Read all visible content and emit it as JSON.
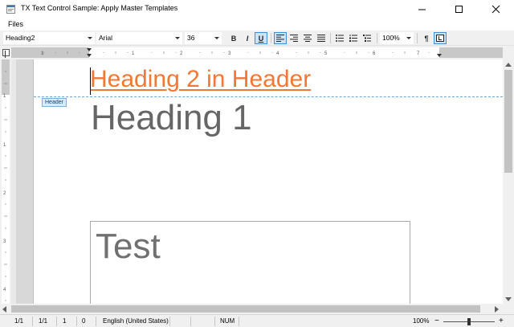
{
  "window": {
    "title": "TX Text Control Sample: Apply Master Templates"
  },
  "menu": {
    "items": [
      "Files"
    ]
  },
  "toolbar": {
    "style_value": "Heading2",
    "font_value": "Arial",
    "size_value": "36",
    "bold_label": "B",
    "italic_label": "I",
    "underline_label": "U",
    "zoom_value": "100%",
    "pilcrow_label": "¶"
  },
  "document": {
    "header_text": "Heading 2 in Header",
    "header_tag": "Header",
    "heading1_text": "Heading 1",
    "frame_text": "Test"
  },
  "status": {
    "page": "1/1",
    "section": "1/1",
    "line": "1",
    "column": "0",
    "language": "English (United States)",
    "num": "NUM",
    "zoom": "100%",
    "zoom_level": 100
  },
  "colors": {
    "header_text": "#f37735",
    "heading_text": "#666666",
    "header_rule": "#6aa6d8",
    "active_button": "#cce4f7"
  },
  "icons": [
    "app-icon",
    "minimize-icon",
    "maximize-icon",
    "close-icon",
    "align-left-icon",
    "align-right-icon",
    "align-center-icon",
    "justify-icon",
    "bullet-list-icon",
    "numbered-list-icon",
    "structured-list-icon",
    "pilcrow-icon",
    "frame-icon"
  ]
}
